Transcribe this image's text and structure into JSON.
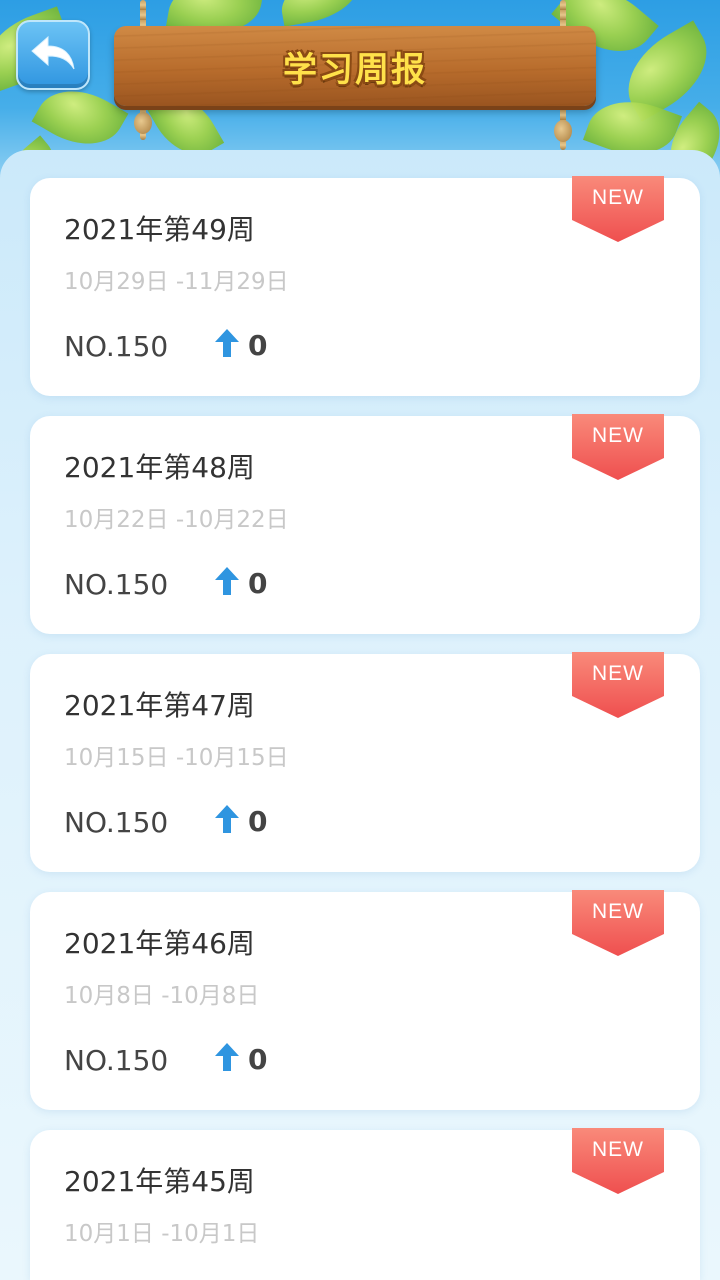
{
  "header": {
    "title": "学习周报",
    "back_icon": "back-arrow-icon"
  },
  "colors": {
    "accent_blue": "#2f95e0",
    "badge_red": "#f25a5a",
    "arrow_blue": "#2f95e0",
    "sign_text": "#ffe14a"
  },
  "reports": [
    {
      "title": "2021年第49周",
      "range": "10月29日 -11月29日",
      "rank": "NO.150",
      "change": "0",
      "badge": "NEW"
    },
    {
      "title": "2021年第48周",
      "range": "10月22日 -10月22日",
      "rank": "NO.150",
      "change": "0",
      "badge": "NEW"
    },
    {
      "title": "2021年第47周",
      "range": "10月15日 -10月15日",
      "rank": "NO.150",
      "change": "0",
      "badge": "NEW"
    },
    {
      "title": "2021年第46周",
      "range": "10月8日 -10月8日",
      "rank": "NO.150",
      "change": "0",
      "badge": "NEW"
    },
    {
      "title": "2021年第45周",
      "range": "10月1日 -10月1日",
      "rank": "",
      "change": "",
      "badge": "NEW"
    }
  ]
}
